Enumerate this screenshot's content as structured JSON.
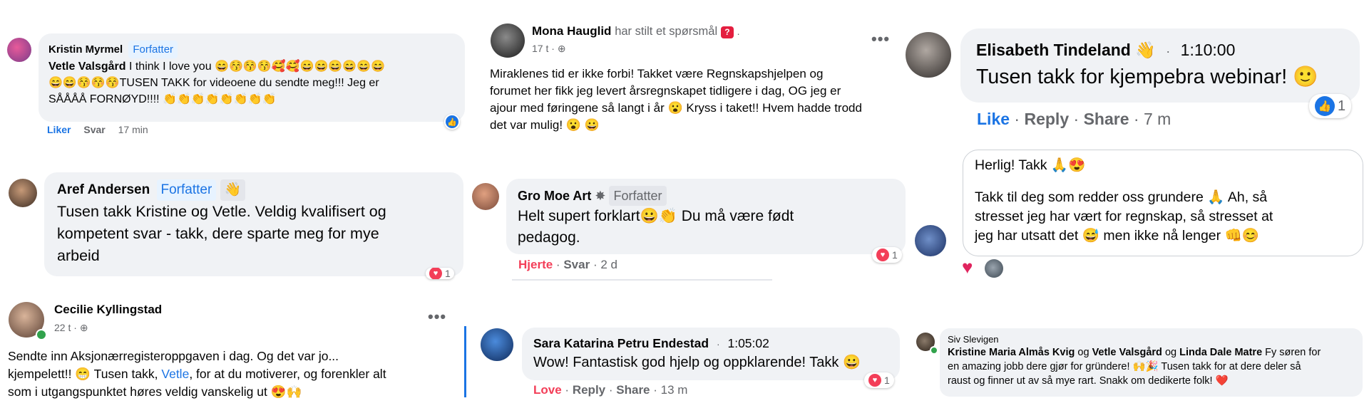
{
  "c1": {
    "author": "Kristin Myrmel",
    "badge": "Forfatter",
    "mention": "Vetle Valsgård",
    "text_part1": "I think I love you 😄😚😚😚🥰🥰😄😄😄😄😄😄",
    "text_part2": "😄😄😚😚😚TUSEN TAKK for videoene du sendte meg!!! Jeg er",
    "text_part3": "SÅÅÅÅ FORNØYD!!!! 👏👏👏👏👏👏👏👏",
    "action_like": "Liker",
    "action_reply": "Svar",
    "time": "17 min"
  },
  "c2": {
    "author": "Aref Andersen",
    "badge": "Forfatter",
    "line1": "Tusen takk Kristine og Vetle. Veldig kvalifisert og",
    "line2": "kompetent svar - takk, dere sparte meg for mye",
    "line3": "arbeid",
    "react_count": "1"
  },
  "c3": {
    "author": "Cecilie Kyllingstad",
    "time": "22 t",
    "line1": "Sendte inn Aksjonærregisteroppgaven i dag. Og det var jo...",
    "line2a": "kjempelett!! 😁 Tusen takk,",
    "mention": "Vetle",
    "line2b": ", for at du motiverer, og forenkler alt",
    "line3": "som i utgangspunktet høres veldig vanskelig ut 😍🙌"
  },
  "c4": {
    "author": "Mona Hauglid",
    "subtitle": "har stilt et spørsmål",
    "time": "17 t",
    "line1": "Miraklenes tid er ikke forbi! Takket være Regnskapshjelpen og",
    "line2": "forumet her fikk jeg levert årsregnskapet tidligere i dag, OG jeg er",
    "line3": "ajour med føringene så langt i år 😮 Kryss i taket!! Hvem hadde trodd",
    "line4": "det var mulig! 😮 😀"
  },
  "c5": {
    "author": "Gro Moe Art",
    "badge": "Forfatter",
    "line1": "Helt supert forklart😀👏 Du må være født",
    "line2": "pedagog.",
    "action_react": "Hjerte",
    "action_reply": "Svar",
    "time": "2 d",
    "react_count": "1"
  },
  "c6": {
    "author": "Sara Katarina Petru Endestad",
    "timestamp": "1:05:02",
    "text": "Wow! Fantastisk god hjelp og oppklarende! Takk 😀",
    "action_react": "Love",
    "action_reply": "Reply",
    "action_share": "Share",
    "time": "13 m",
    "react_count": "1"
  },
  "c7": {
    "author": "Elisabeth Tindeland",
    "timestamp": "1:10:00",
    "text": "Tusen takk for kjempebra webinar! 🙂",
    "action_like": "Like",
    "action_reply": "Reply",
    "action_share": "Share",
    "time": "7 m",
    "react_count": "1"
  },
  "c8": {
    "line1": "Herlig! Takk 🙏😍",
    "line2": "Takk til deg som redder oss grundere 🙏 Ah, så",
    "line3": "stresset jeg har vært for regnskap, så stresset at",
    "line4": "jeg har utsatt det 😅 men ikke nå lenger 👊😊"
  },
  "c9": {
    "author": "Siv Slevigen",
    "mention1": "Kristine Maria Almås Kvig",
    "conj1": "og",
    "mention2": "Vetle Valsgård",
    "conj2": "og",
    "mention3": "Linda Dale Matre",
    "text1": "Fy søren for",
    "text2": "en amazing jobb dere gjør for gründere! 🙌🎉 Tusen takk for at dere deler så",
    "text3": "raust og finner ut av så mye rart. Snakk om dedikerte folk! ❤️"
  },
  "colors": {
    "facebook_blue": "#1b74e4",
    "bubble_gray": "#f0f2f5",
    "love_red": "#f33e58",
    "meta_gray": "#65676b"
  }
}
